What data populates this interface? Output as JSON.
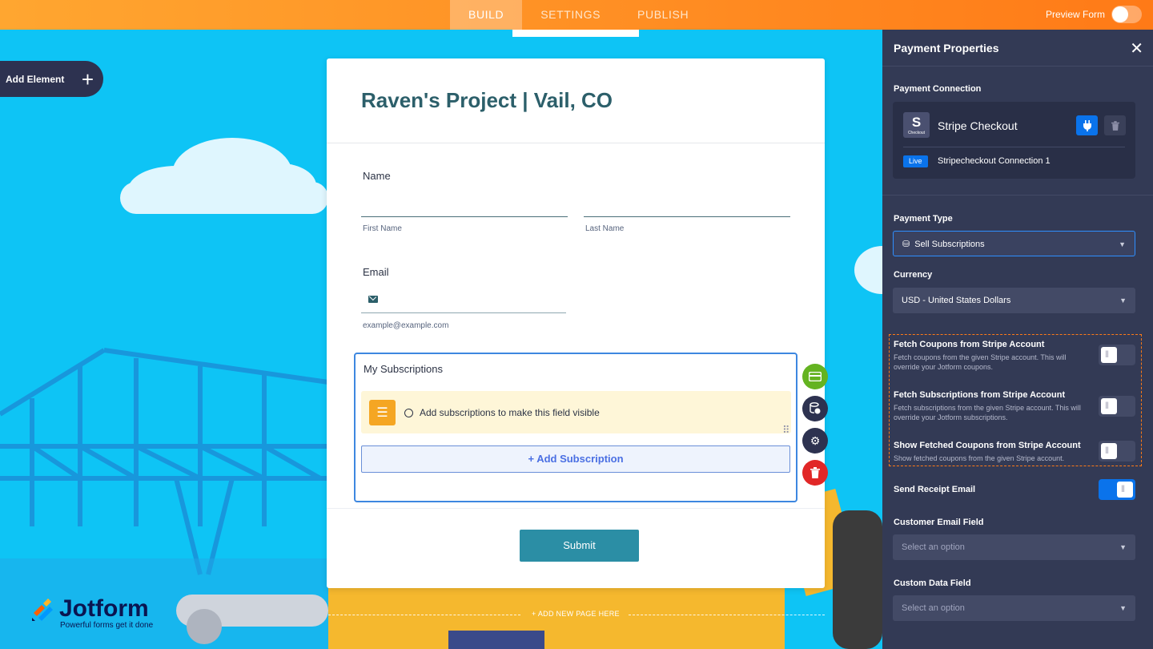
{
  "topbar": {
    "tabs": [
      "BUILD",
      "SETTINGS",
      "PUBLISH"
    ],
    "active_tab": "BUILD",
    "preview_label": "Preview Form"
  },
  "canvas": {
    "add_element_label": "Add Element",
    "add_page_label": "+ ADD NEW PAGE HERE",
    "brand_name": "Jotform",
    "brand_tagline": "Powerful forms get it done"
  },
  "form": {
    "title": "Raven's Project | Vail, CO",
    "name_label": "Name",
    "first_name_sublabel": "First Name",
    "last_name_sublabel": "Last Name",
    "email_label": "Email",
    "email_sublabel": "example@example.com",
    "subscriptions_label": "My Subscriptions",
    "subscriptions_notice": "Add subscriptions to make this field visible",
    "add_subscription_label": "+ Add Subscription",
    "submit_label": "Submit"
  },
  "panel": {
    "title": "Payment Properties",
    "payment_connection_label": "Payment Connection",
    "gateway_name": "Stripe Checkout",
    "gateway_logo_letter": "S",
    "gateway_logo_caption": "Checkout",
    "mode_badge": "Live",
    "connection_name": "Stripecheckout Connection 1",
    "payment_type_label": "Payment Type",
    "payment_type_value": "Sell Subscriptions",
    "currency_label": "Currency",
    "currency_value": "USD - United States Dollars",
    "options": [
      {
        "title": "Fetch Coupons from Stripe Account",
        "desc": "Fetch coupons from the given Stripe account. This will override your Jotform coupons.",
        "enabled": false
      },
      {
        "title": "Fetch Subscriptions from Stripe Account",
        "desc": "Fetch subscriptions from the given Stripe account. This will override your Jotform subscriptions.",
        "enabled": false
      },
      {
        "title": "Show Fetched Coupons from Stripe Account",
        "desc": "Show fetched coupons from the given Stripe account.",
        "enabled": false
      }
    ],
    "send_receipt_label": "Send Receipt Email",
    "send_receipt_enabled": true,
    "customer_email_label": "Customer Email Field",
    "customer_email_placeholder": "Select an option",
    "custom_data_label": "Custom Data Field",
    "custom_data_placeholder": "Select an option"
  },
  "colors": {
    "topbar_orange": "#ff8c22",
    "canvas_blue": "#12c6f7",
    "panel_bg": "#333a55",
    "accent_blue": "#0a73eb",
    "submit_teal": "#2b8ea5",
    "highlight_orange": "#ff7a17"
  }
}
